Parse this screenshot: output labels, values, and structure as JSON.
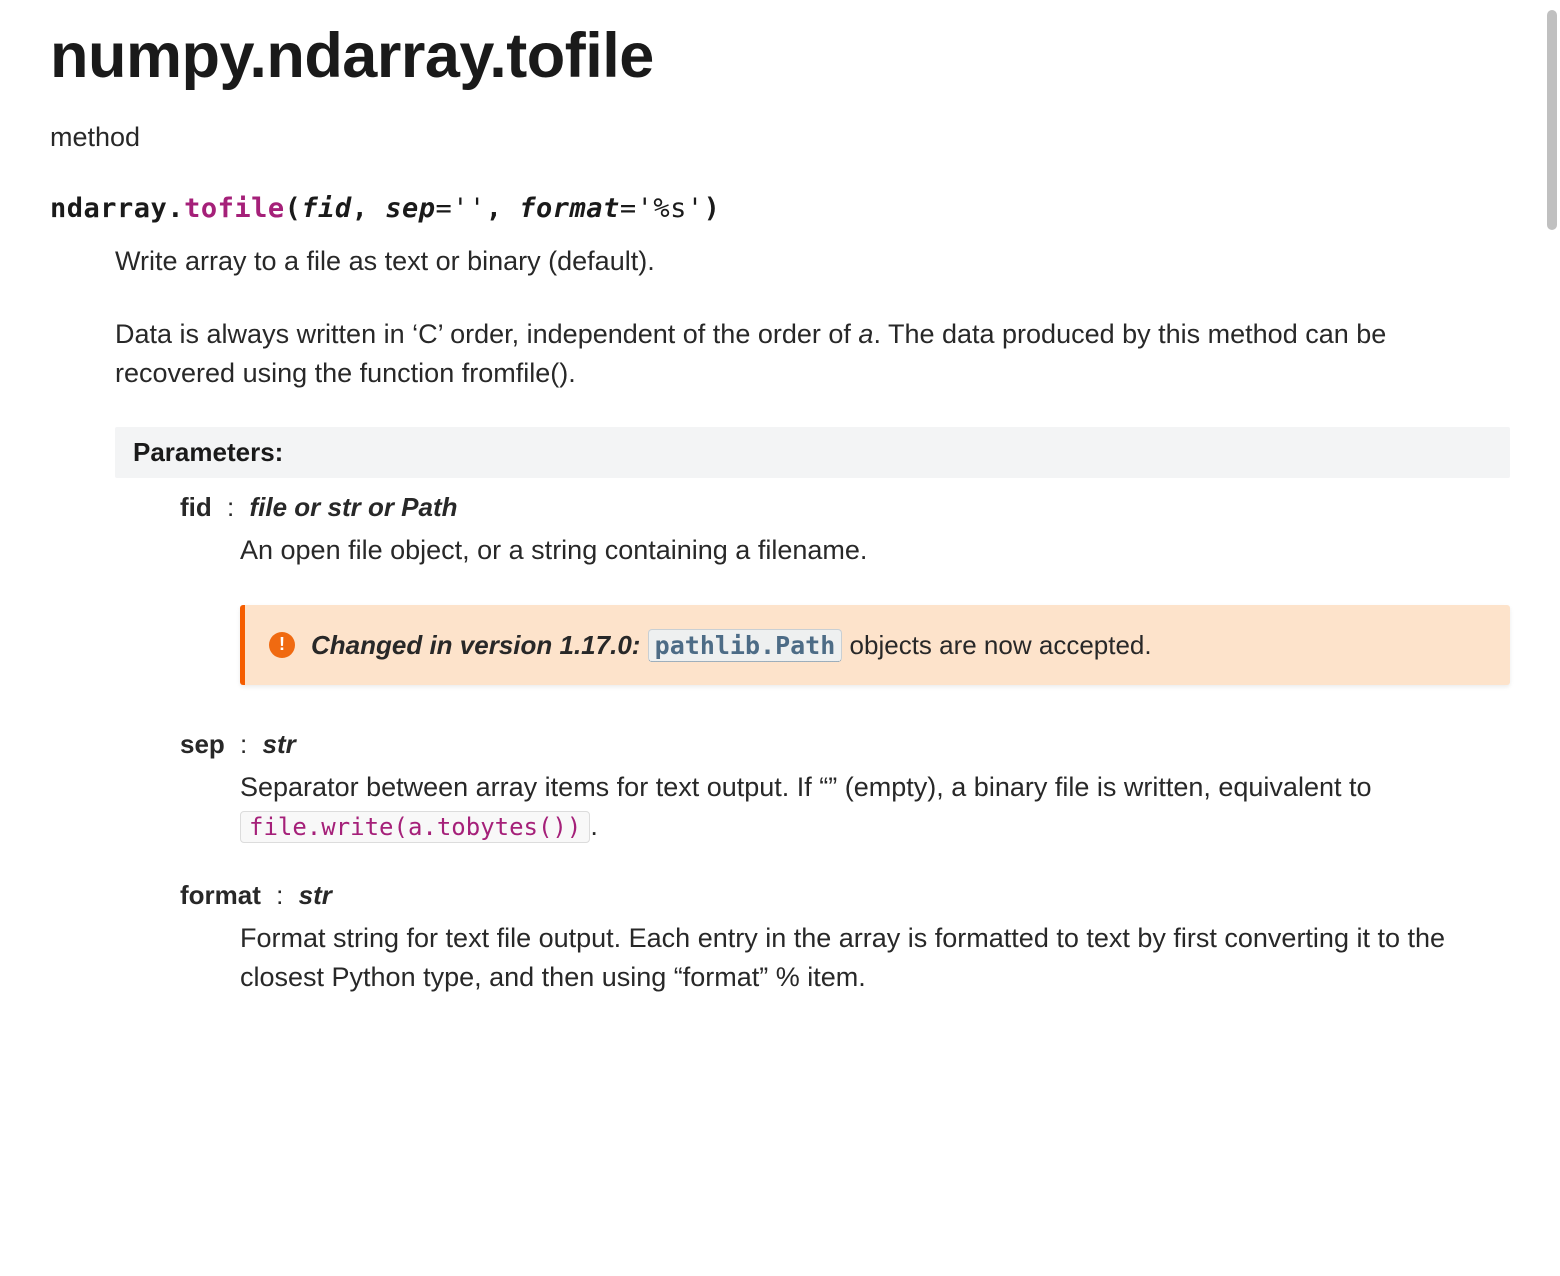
{
  "title": "numpy.ndarray.tofile",
  "kind": "method",
  "signature": {
    "class": "ndarray",
    "dot": ".",
    "method": "tofile",
    "open": "(",
    "close": ")",
    "comma": ",",
    "params": [
      {
        "name": "fid"
      },
      {
        "name": "sep",
        "eq": "=",
        "default": "''"
      },
      {
        "name": "format",
        "eq": "=",
        "default": "'%s'"
      }
    ]
  },
  "desc1": "Write array to a file as text or binary (default).",
  "desc2_pre": "Data is always written in ‘C’ order, independent of the order of ",
  "desc2_ital": "a",
  "desc2_post": ". The data produced by this method can be recovered using the function fromfile().",
  "parameters_label": "Parameters:",
  "params_list": [
    {
      "name": "fid",
      "colon": ":",
      "type": "file or str or Path",
      "desc": "An open file object, or a string containing a filename.",
      "admon": {
        "icon": "!",
        "label": "Changed in version 1.17.0:",
        "code": "pathlib.Path",
        "rest": " objects are now accepted."
      }
    },
    {
      "name": "sep",
      "colon": ":",
      "type": "str",
      "desc_pre": "Separator between array items for text output. If “” (empty), a binary file is written, equivalent to ",
      "code": "file.write(a.tobytes())",
      "desc_post": "."
    },
    {
      "name": "format",
      "colon": ":",
      "type": "str",
      "desc": "Format string for text file output. Each entry in the array is formatted to text by first converting it to the closest Python type, and then using “format” % item."
    }
  ]
}
